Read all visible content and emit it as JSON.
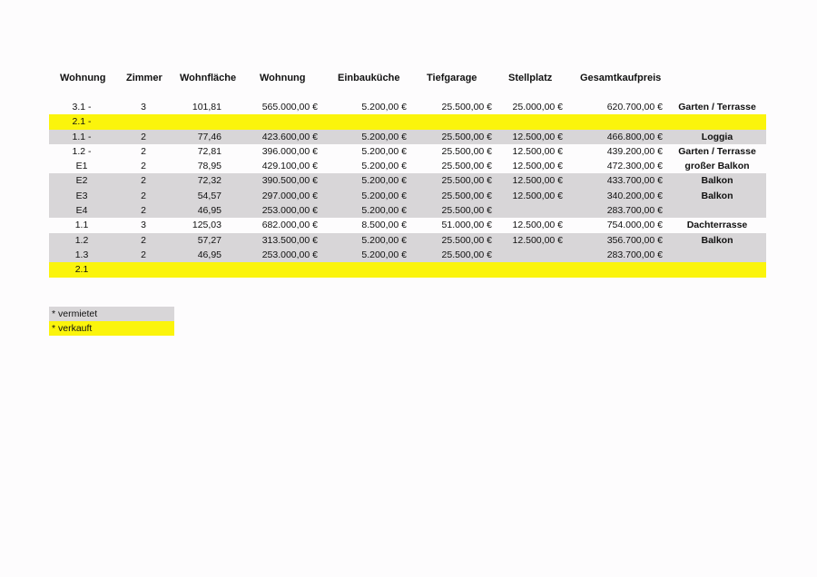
{
  "headers": {
    "wohnung": "Wohnung",
    "zimmer": "Zimmer",
    "wohnflaeche": "Wohnfläche",
    "wohnung_preis": "Wohnung",
    "einbaukueche": "Einbauküche",
    "tiefgarage": "Tiefgarage",
    "stellplatz": "Stellplatz",
    "gesamtkaufpreis": "Gesamtkaufpreis"
  },
  "rows": [
    {
      "status": "white",
      "wohnung": "3.1 -",
      "zimmer": "3",
      "flaeche": "101,81",
      "preis": "565.000,00 €",
      "kueche": "5.200,00 €",
      "garage": "25.500,00 €",
      "stell": "25.000,00 €",
      "gesamt": "620.700,00 €",
      "extra": "Garten / Terrasse"
    },
    {
      "status": "yellow",
      "wohnung": "2.1 -",
      "zimmer": "",
      "flaeche": "",
      "preis": "",
      "kueche": "",
      "garage": "",
      "stell": "",
      "gesamt": "",
      "extra": ""
    },
    {
      "status": "gray",
      "wohnung": "1.1 -",
      "zimmer": "2",
      "flaeche": "77,46",
      "preis": "423.600,00 €",
      "kueche": "5.200,00 €",
      "garage": "25.500,00 €",
      "stell": "12.500,00 €",
      "gesamt": "466.800,00 €",
      "extra": "Loggia"
    },
    {
      "status": "white",
      "wohnung": "1.2 -",
      "zimmer": "2",
      "flaeche": "72,81",
      "preis": "396.000,00 €",
      "kueche": "5.200,00 €",
      "garage": "25.500,00 €",
      "stell": "12.500,00 €",
      "gesamt": "439.200,00 €",
      "extra": "Garten / Terrasse"
    },
    {
      "status": "white",
      "wohnung": "E1",
      "zimmer": "2",
      "flaeche": "78,95",
      "preis": "429.100,00 €",
      "kueche": "5.200,00 €",
      "garage": "25.500,00 €",
      "stell": "12.500,00 €",
      "gesamt": "472.300,00 €",
      "extra": "großer Balkon"
    },
    {
      "status": "gray",
      "wohnung": "E2",
      "zimmer": "2",
      "flaeche": "72,32",
      "preis": "390.500,00 €",
      "kueche": "5.200,00 €",
      "garage": "25.500,00 €",
      "stell": "12.500,00 €",
      "gesamt": "433.700,00 €",
      "extra": "Balkon"
    },
    {
      "status": "gray",
      "wohnung": "E3",
      "zimmer": "2",
      "flaeche": "54,57",
      "preis": "297.000,00 €",
      "kueche": "5.200,00 €",
      "garage": "25.500,00 €",
      "stell": "12.500,00 €",
      "gesamt": "340.200,00 €",
      "extra": "Balkon"
    },
    {
      "status": "gray",
      "wohnung": "E4",
      "zimmer": "2",
      "flaeche": "46,95",
      "preis": "253.000,00 €",
      "kueche": "5.200,00 €",
      "garage": "25.500,00 €",
      "stell": "",
      "gesamt": "283.700,00 €",
      "extra": ""
    },
    {
      "status": "white",
      "wohnung": "1.1",
      "zimmer": "3",
      "flaeche": "125,03",
      "preis": "682.000,00 €",
      "kueche": "8.500,00 €",
      "garage": "51.000,00 €",
      "stell": "12.500,00 €",
      "gesamt": "754.000,00 €",
      "extra": "Dachterrasse"
    },
    {
      "status": "gray",
      "wohnung": "1.2",
      "zimmer": "2",
      "flaeche": "57,27",
      "preis": "313.500,00 €",
      "kueche": "5.200,00 €",
      "garage": "25.500,00 €",
      "stell": "12.500,00 €",
      "gesamt": "356.700,00 €",
      "extra": "Balkon"
    },
    {
      "status": "gray",
      "wohnung": "1.3",
      "zimmer": "2",
      "flaeche": "46,95",
      "preis": "253.000,00 €",
      "kueche": "5.200,00 €",
      "garage": "25.500,00 €",
      "stell": "",
      "gesamt": "283.700,00 €",
      "extra": ""
    },
    {
      "status": "yellow",
      "wohnung": "2.1",
      "zimmer": "",
      "flaeche": "",
      "preis": "",
      "kueche": "",
      "garage": "",
      "stell": "",
      "gesamt": "",
      "extra": ""
    }
  ],
  "legend": {
    "vermietet": "* vermietet",
    "verkauft": "* verkauft"
  },
  "colors": {
    "vermietet": "#d8d6d8",
    "verkauft": "#fbf40c"
  }
}
